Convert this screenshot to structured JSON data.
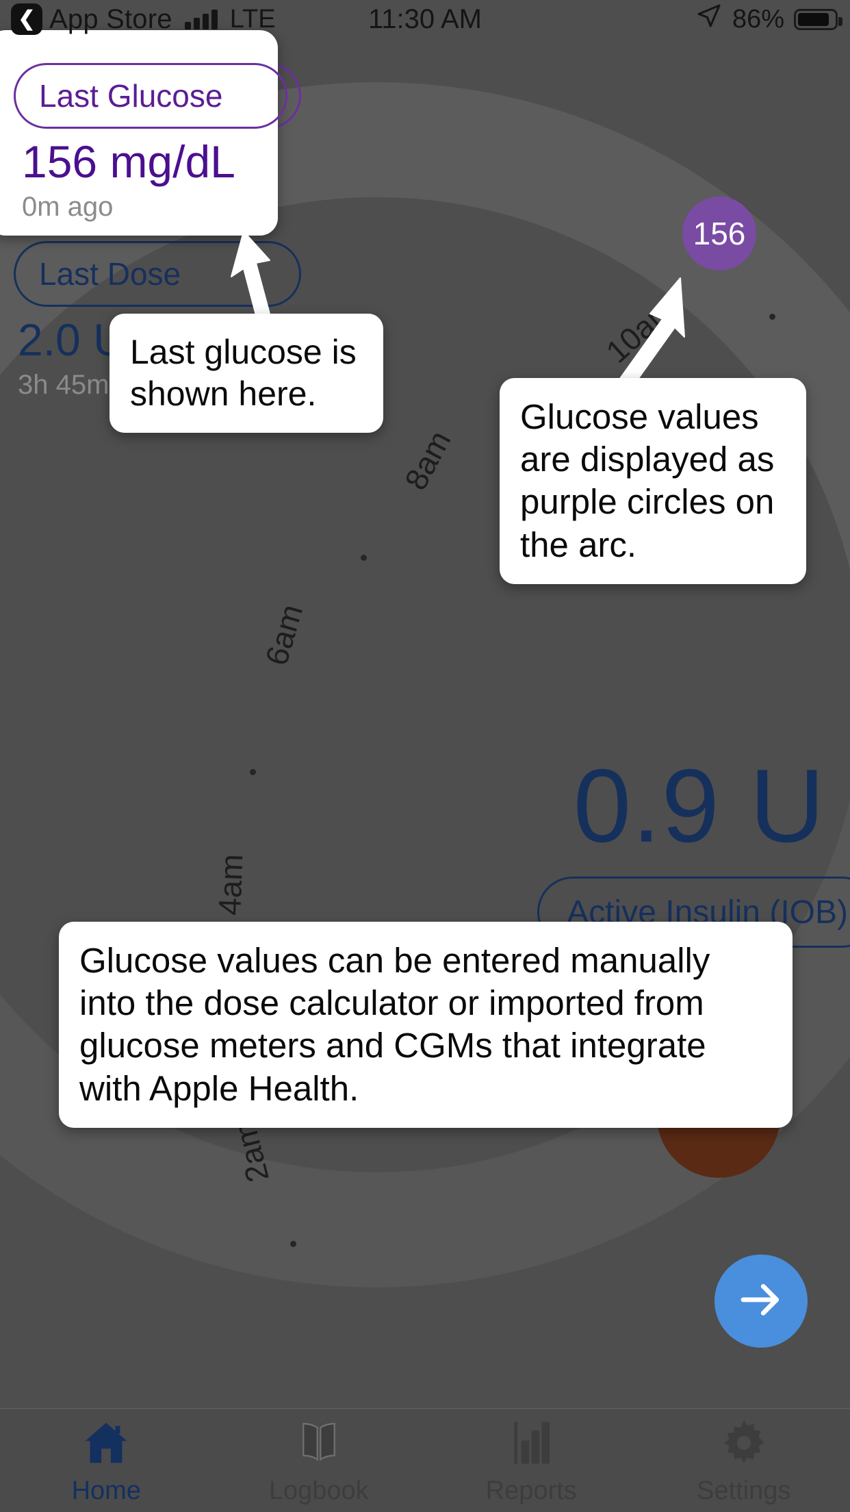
{
  "status_bar": {
    "back_label": "App Store",
    "back_icon": "chevron-left-icon",
    "carrier_network": "LTE",
    "time": "11:30 AM",
    "location_icon": "location-arrow-icon",
    "battery_percent": "86%"
  },
  "last_glucose_card": {
    "title": "Last Glucose",
    "value": "156 mg/dL",
    "age": "0m ago"
  },
  "last_dose_card": {
    "title": "Last Dose",
    "value": "2.0 U",
    "age": "3h 45m"
  },
  "active_insulin": {
    "value": "0.9 U",
    "label": "Active Insulin (IOB)"
  },
  "clock_arc": {
    "hour_labels": [
      "10am",
      "8am",
      "6am",
      "4am",
      "2am"
    ],
    "glucose_points": [
      {
        "value": "156",
        "color": "#7a4ba3"
      }
    ],
    "carb_marker_color": "#5a2a14",
    "tick_count": 5
  },
  "coach_marks": [
    {
      "id": "last-glucose",
      "text": "Last glucose is shown here."
    },
    {
      "id": "purple-circles",
      "text": "Glucose values are displayed as purple circles on the arc."
    },
    {
      "id": "manual-entry",
      "text": "Glucose values can be entered manually into the dose calculator or imported from glucose meters and CGMs that integrate with Apple Health."
    }
  ],
  "next_button": {
    "icon": "arrow-right-icon",
    "color": "#4a8fdd"
  },
  "tab_bar": {
    "active": "Home",
    "items": [
      {
        "label": "Home",
        "icon": "home-icon"
      },
      {
        "label": "Logbook",
        "icon": "book-icon"
      },
      {
        "label": "Reports",
        "icon": "bar-chart-icon"
      },
      {
        "label": "Settings",
        "icon": "gear-icon"
      }
    ]
  },
  "colors": {
    "accent_blue": "#16305c",
    "glucose_purple": "#7a4ba3",
    "next_blue": "#4a8fdd",
    "background": "#4e4e4e"
  }
}
